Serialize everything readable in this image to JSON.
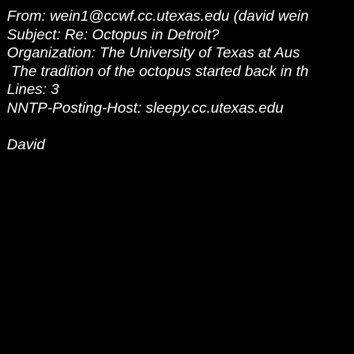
{
  "message": {
    "headers": {
      "from": "From: wein1@ccwf.cc.utexas.edu (david wein",
      "subject": "Subject: Re: Octopus in Detroit?",
      "organization": "Organization: The University of Texas at Aus",
      "summary": " The tradition of the octopus started back in th",
      "lines": "Lines: 3",
      "nntp_posting_host": "NNTP-Posting-Host: sleepy.cc.utexas.edu"
    },
    "body": "David"
  },
  "colors": {
    "background": "#000000",
    "text": "#ffffff"
  }
}
